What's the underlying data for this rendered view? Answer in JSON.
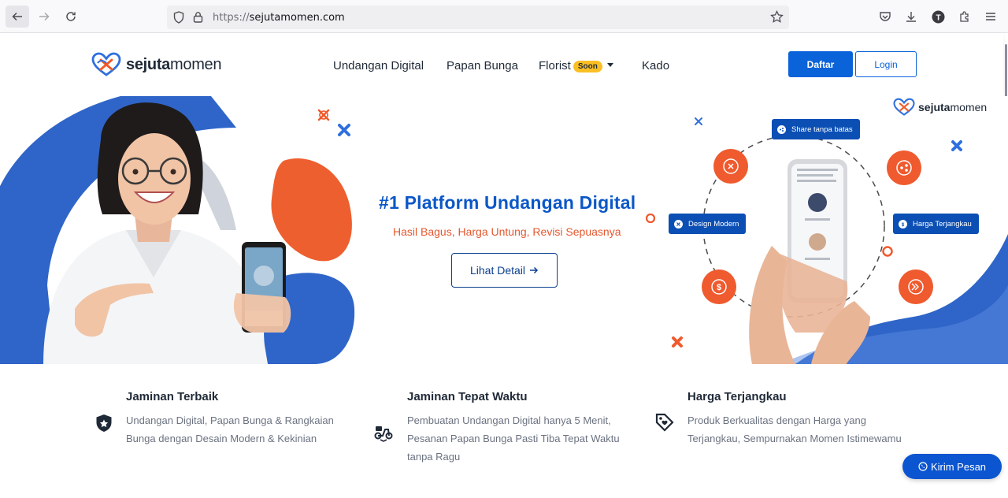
{
  "browser": {
    "url_proto": "https://",
    "url_host": "sejutamomen.com"
  },
  "header": {
    "logo_bold": "sejuta",
    "logo_light": "momen",
    "nav": [
      {
        "label": "Undangan Digital"
      },
      {
        "label": "Papan Bunga"
      },
      {
        "label": "Florist",
        "badge": "Soon"
      },
      {
        "label": "Kado"
      }
    ],
    "daftar_label": "Daftar",
    "login_label": "Login"
  },
  "hero": {
    "title": "#1 Platform Undangan Digital",
    "subtitle": "Hasil Bagus, Harga Untung, Revisi Sepuasnya",
    "cta_label": "Lihat Detail",
    "logo_bold": "sejuta",
    "logo_light": "momen",
    "pills": {
      "share": "Share tanpa batas",
      "design": "Design Modern",
      "harga": "Harga Terjangkau"
    }
  },
  "features": [
    {
      "title": "Jaminan Terbaik",
      "line1": "Undangan Digital, Papan Bunga & Rangkaian",
      "line2": "Bunga dengan Desain Modern & Kekinian",
      "line3": "",
      "icon": "shield-star-icon"
    },
    {
      "title": "Jaminan Tepat Waktu",
      "line1": "Pembuatan Undangan Digital hanya 5 Menit,",
      "line2": "Pesanan Papan Bunga Pasti Tiba Tepat Waktu",
      "line3": "tanpa Ragu",
      "icon": "delivery-scooter-icon"
    },
    {
      "title": "Harga Terjangkau",
      "line1": "Produk Berkualitas dengan Harga yang",
      "line2": "Terjangkau, Sempurnakan Momen Istimewamu",
      "line3": "",
      "icon": "price-tag-icon"
    }
  ],
  "chat": {
    "label": "Kirim Pesan"
  },
  "colors": {
    "brand_blue": "#0b63d9",
    "accent_orange": "#e4572e",
    "soon_badge": "#fbbf24"
  }
}
